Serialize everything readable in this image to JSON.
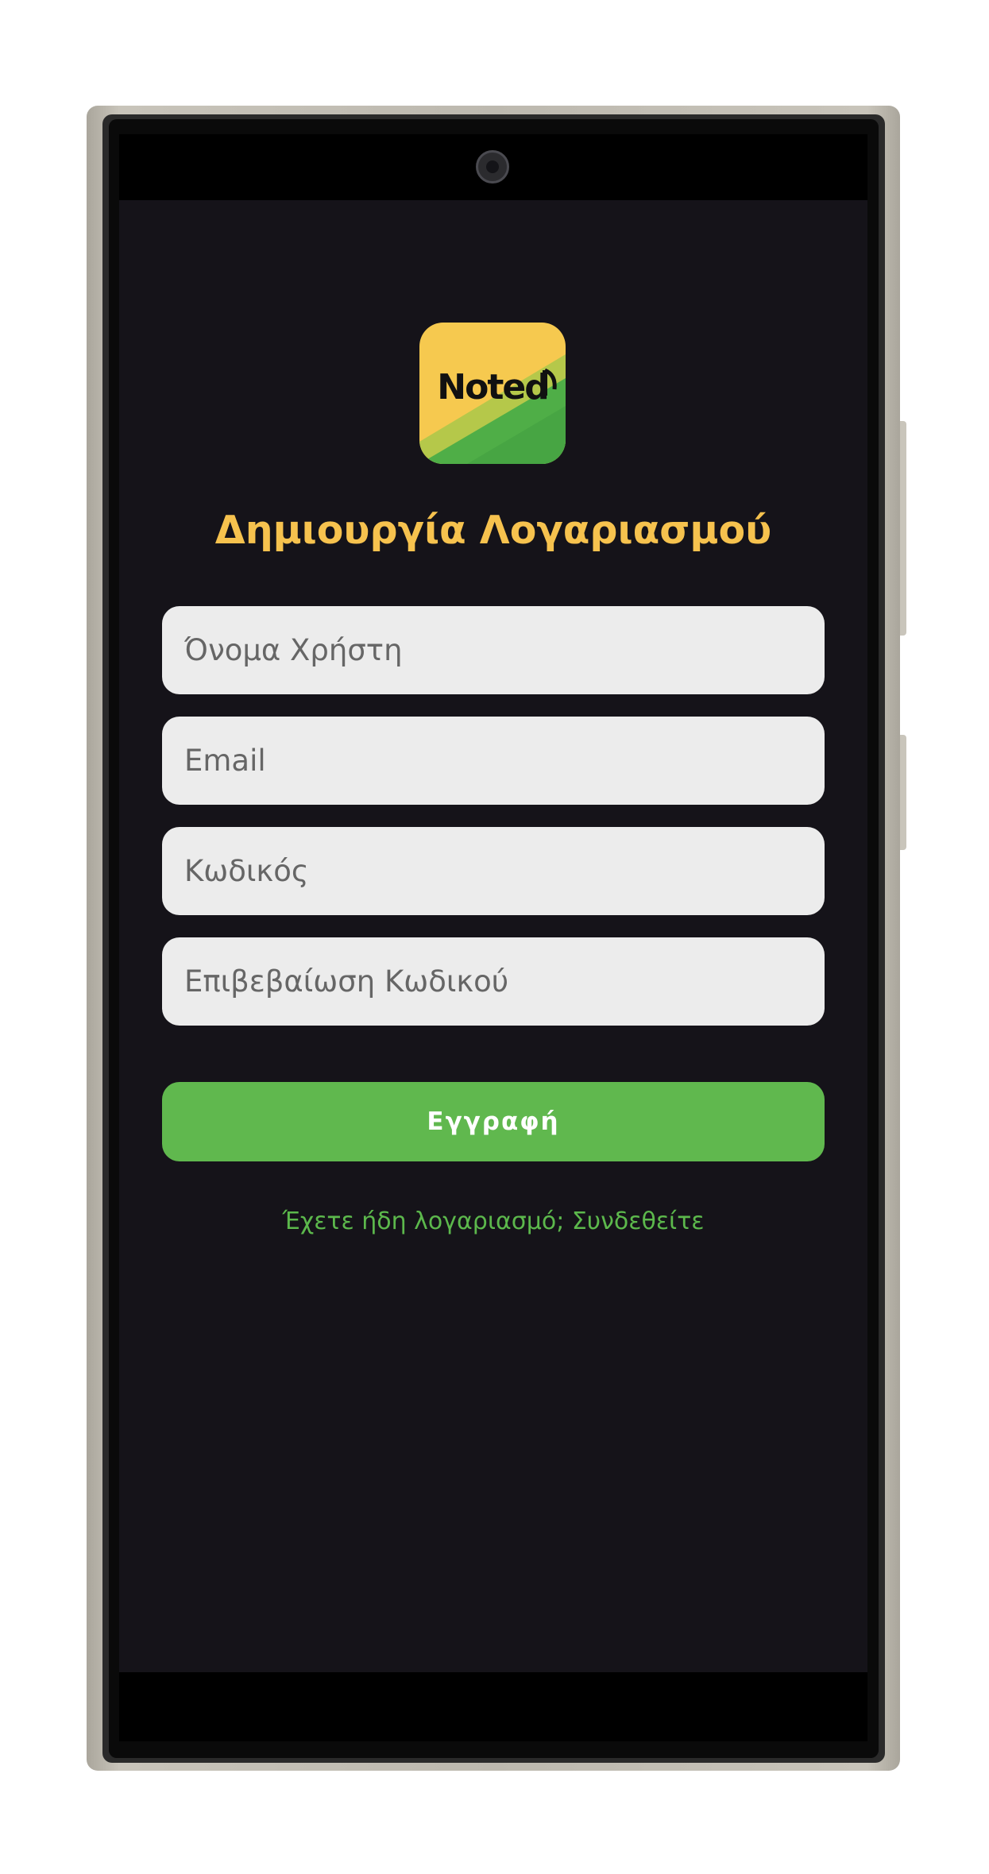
{
  "app": {
    "logo_text": "Noted",
    "title": "Δημιουργία Λογαριασμού"
  },
  "form": {
    "username_placeholder": "Όνομα Χρήστη",
    "email_placeholder": "Email",
    "password_placeholder": "Κωδικός",
    "confirm_password_placeholder": "Επιβεβαίωση Κωδικού",
    "register_label": "Εγγραφή",
    "login_link": "Έχετε ήδη λογαριασμό; Συνδεθείτε"
  },
  "colors": {
    "background": "#151319",
    "title": "#f6c24e",
    "accent": "#60b84e",
    "field_bg": "#ececec",
    "logo_yellow": "#f6c94f",
    "logo_green": "#4fae47"
  },
  "icons": {
    "logo": "noted-music-note-logo",
    "camera": "front-camera"
  }
}
